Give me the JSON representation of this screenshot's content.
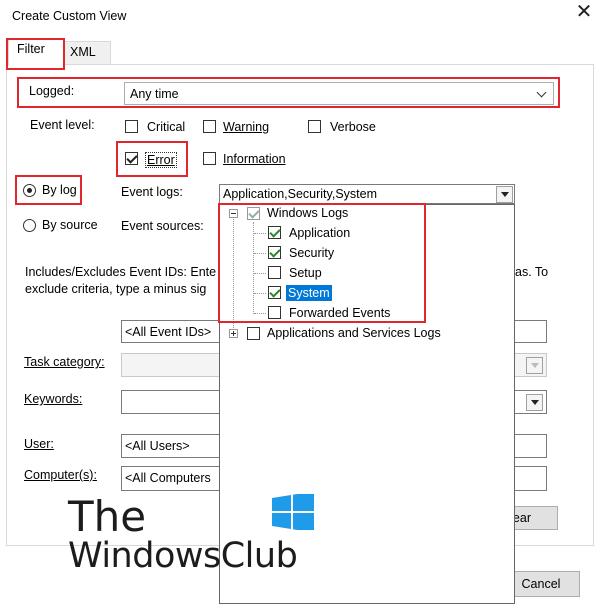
{
  "window": {
    "title": "Create Custom View",
    "close_glyph": "✕"
  },
  "tabs": [
    {
      "label": "Filter",
      "active": true
    },
    {
      "label": "XML",
      "active": false
    }
  ],
  "logged": {
    "label": "Logged:",
    "value": "Any time"
  },
  "event_level": {
    "label": "Event level:",
    "options": [
      {
        "label": "Critical",
        "checked": false
      },
      {
        "label": "Warning",
        "checked": false
      },
      {
        "label": "Verbose",
        "checked": false
      },
      {
        "label": "Error",
        "checked": true
      },
      {
        "label": "Information",
        "checked": false
      }
    ]
  },
  "scope": {
    "by_log": {
      "label": "By log",
      "selected": true
    },
    "by_source": {
      "label": "By source",
      "selected": false
    }
  },
  "event_logs": {
    "label": "Event logs:",
    "value": "Application,Security,System"
  },
  "event_sources": {
    "label": "Event sources:"
  },
  "ids": {
    "desc_line1": "Includes/Excludes Event IDs: Ente",
    "desc_line1_tail": "as. To",
    "desc_line2": "exclude criteria, type a minus sig",
    "value": "<All Event IDs>"
  },
  "task_category": {
    "label": "Task category:"
  },
  "keywords": {
    "label": "Keywords:"
  },
  "user": {
    "label": "User:",
    "value": "<All Users>"
  },
  "computers": {
    "label": "Computer(s):",
    "value": "<All Computers"
  },
  "buttons": {
    "clear": "lear",
    "cancel": "Cancel"
  },
  "log_tree": {
    "windows_logs": {
      "label": "Windows Logs",
      "checked": true
    },
    "children": [
      {
        "label": "Application",
        "checked": true,
        "selected": false
      },
      {
        "label": "Security",
        "checked": true,
        "selected": false
      },
      {
        "label": "Setup",
        "checked": false,
        "selected": false
      },
      {
        "label": "System",
        "checked": true,
        "selected": true
      },
      {
        "label": "Forwarded Events",
        "checked": false,
        "selected": false
      }
    ],
    "app_services": {
      "label": "Applications and Services Logs",
      "checked": false
    }
  },
  "watermark": {
    "line1": "The",
    "line2": "WindowsClub"
  },
  "colors": {
    "highlight": "#e1262e",
    "selection": "#0078d7",
    "check": "#2a8a2a",
    "logo_blue": "#1e9be9"
  }
}
